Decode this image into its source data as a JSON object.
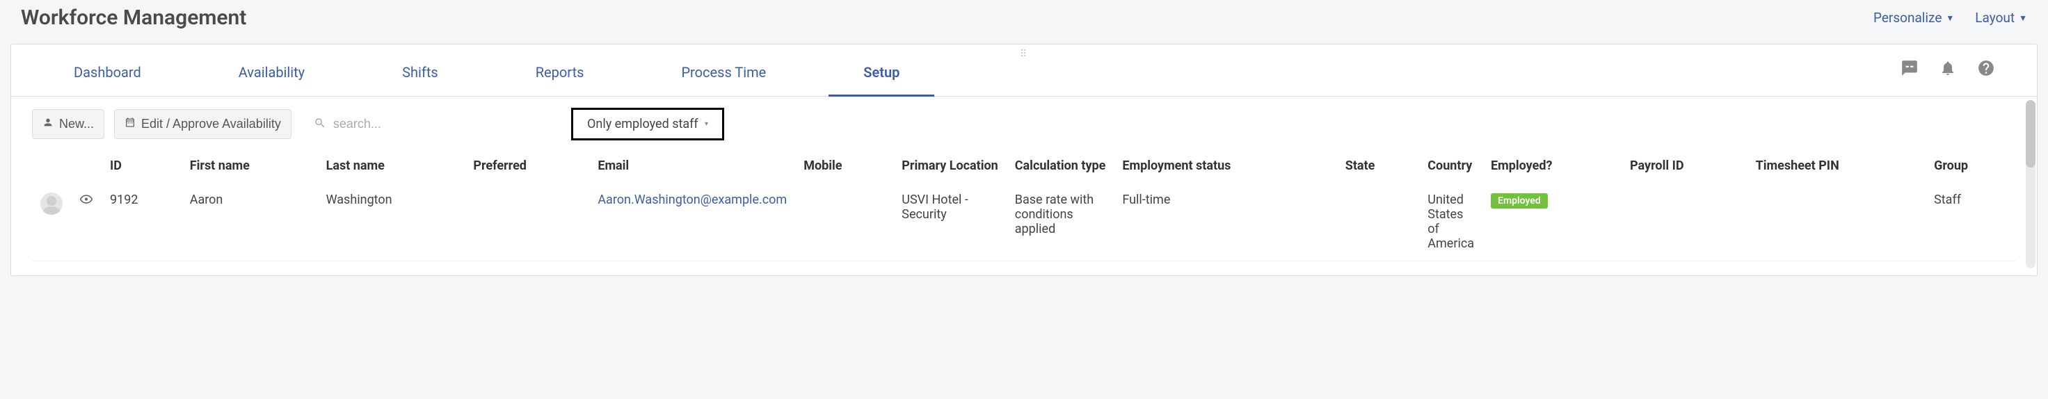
{
  "header": {
    "title": "Workforce Management",
    "personalize": "Personalize",
    "layout": "Layout"
  },
  "tabs": {
    "items": [
      {
        "label": "Dashboard"
      },
      {
        "label": "Availability"
      },
      {
        "label": "Shifts"
      },
      {
        "label": "Reports"
      },
      {
        "label": "Process Time"
      },
      {
        "label": "Setup"
      }
    ],
    "active_index": 5
  },
  "toolbar": {
    "new_label": "New...",
    "edit_label": "Edit / Approve Availability",
    "search_placeholder": "search...",
    "filter_value": "Only employed staff"
  },
  "table": {
    "columns": {
      "id": "ID",
      "first_name": "First name",
      "last_name": "Last name",
      "preferred": "Preferred",
      "email": "Email",
      "mobile": "Mobile",
      "primary_location": "Primary Location",
      "calc_type": "Calculation type",
      "emp_status": "Employment status",
      "state": "State",
      "country": "Country",
      "employed": "Employed?",
      "payroll_id": "Payroll ID",
      "timesheet_pin": "Timesheet PIN",
      "group": "Group"
    },
    "rows": [
      {
        "id": "9192",
        "first_name": "Aaron",
        "last_name": "Washington",
        "preferred": "",
        "email": "Aaron.Washington@example.com",
        "mobile": "",
        "primary_location": "USVI Hotel - Security",
        "calc_type": "Base rate with conditions applied",
        "emp_status": "Full-time",
        "state": "",
        "country": "United States of America",
        "employed_badge": "Employed",
        "payroll_id": "",
        "timesheet_pin": "",
        "group": "Staff"
      }
    ]
  }
}
